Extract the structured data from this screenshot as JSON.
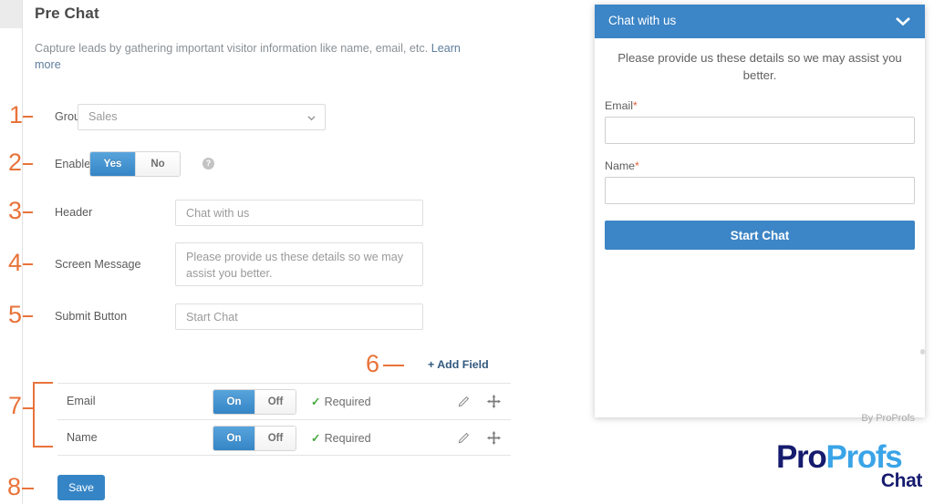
{
  "panel": {
    "title": "Pre Chat",
    "description": "Capture leads by gathering important visitor information like name, email, etc. ",
    "description_link": "Learn more",
    "rows": {
      "group": {
        "label": "Group",
        "value": "Sales",
        "options": [
          "Sales"
        ],
        "icon": "chevron-down-icon"
      },
      "enable": {
        "label": "Enable",
        "yes_label": "Yes",
        "no_label": "No",
        "selected": "Yes",
        "help_icon": "question-mark-icon"
      },
      "header": {
        "label": "Header",
        "value": "Chat with us"
      },
      "screen_message": {
        "label": "Screen Message",
        "value": "Please provide us these details so we may assist you better."
      },
      "submit_button": {
        "label": "Submit Button",
        "value": "Start Chat"
      }
    },
    "add_field_label": "+ Add Field",
    "fields": [
      {
        "name": "Email",
        "on_label": "On",
        "off_label": "Off",
        "state": "On",
        "required_label": "Required",
        "required_icon": "check-icon",
        "edit_icon": "pencil-icon",
        "drag_icon": "move-arrows-icon"
      },
      {
        "name": "Name",
        "on_label": "On",
        "off_label": "Off",
        "state": "On",
        "required_label": "Required",
        "required_icon": "check-icon",
        "edit_icon": "pencil-icon",
        "drag_icon": "move-arrows-icon"
      }
    ],
    "save_label": "Save"
  },
  "annotations": {
    "n1": "1",
    "n2": "2",
    "n3": "3",
    "n4": "4",
    "n5": "5",
    "n6": "6",
    "n7": "7",
    "n8": "8",
    "color": "#e8733a"
  },
  "widget": {
    "header_title": "Chat with us",
    "collapse_icon": "chevron-down-icon",
    "message": "Please provide us these details so we may assist you better.",
    "fields": [
      {
        "label": "Email",
        "required_marker": "*",
        "value": ""
      },
      {
        "label": "Name",
        "required_marker": "*",
        "value": ""
      }
    ],
    "submit_label": "Start Chat",
    "footer": "By ProProfs",
    "accent_color": "#3c85c6"
  },
  "logo": {
    "part1": "Pro",
    "part2": "Profs",
    "part3": "Chat",
    "color1": "#151b6e",
    "color2": "#3aa4e8"
  }
}
